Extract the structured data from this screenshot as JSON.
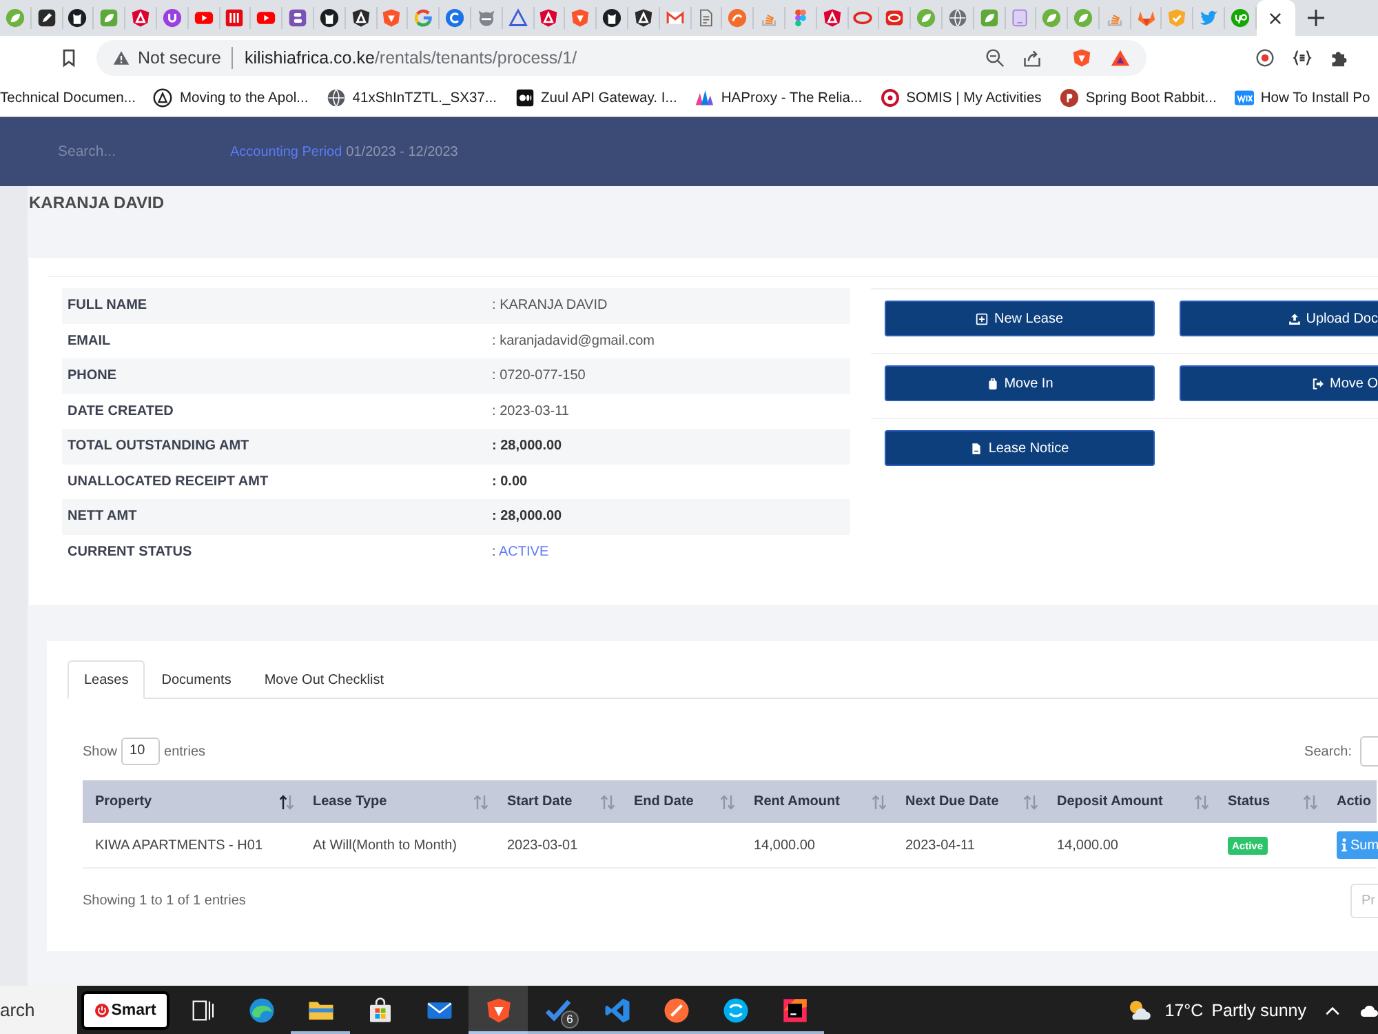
{
  "browser": {
    "tabs": [
      {
        "kind": "leaf",
        "selected": false
      },
      {
        "kind": "pencil",
        "selected": false
      },
      {
        "kind": "cat",
        "selected": false
      },
      {
        "kind": "leaf-square",
        "selected": false
      },
      {
        "kind": "shield",
        "selected": false
      },
      {
        "kind": "cup",
        "selected": false
      },
      {
        "kind": "play",
        "selected": false
      },
      {
        "kind": "stripes",
        "selected": false
      },
      {
        "kind": "play",
        "selected": false
      },
      {
        "kind": "bars",
        "selected": false
      },
      {
        "kind": "cat",
        "selected": false
      },
      {
        "kind": "dark-shield",
        "selected": false
      },
      {
        "kind": "lion",
        "selected": false
      },
      {
        "kind": "ring",
        "selected": false
      },
      {
        "kind": "arc",
        "selected": false
      },
      {
        "kind": "head",
        "selected": false
      },
      {
        "kind": "triangle",
        "selected": false
      },
      {
        "kind": "shield",
        "selected": false
      },
      {
        "kind": "lion",
        "selected": false
      },
      {
        "kind": "cat",
        "selected": false
      },
      {
        "kind": "dark-shield",
        "selected": false
      },
      {
        "kind": "envelope",
        "selected": false
      },
      {
        "kind": "scroll",
        "selected": false
      },
      {
        "kind": "swirl",
        "selected": false
      },
      {
        "kind": "stack",
        "selected": false
      },
      {
        "kind": "circles",
        "selected": false
      },
      {
        "kind": "shield",
        "selected": false
      },
      {
        "kind": "oval",
        "selected": false
      },
      {
        "kind": "oval-square",
        "selected": false
      },
      {
        "kind": "leaf",
        "selected": false
      },
      {
        "kind": "globe",
        "selected": false
      },
      {
        "kind": "leaf-square",
        "selected": false
      },
      {
        "kind": "tablet",
        "selected": false
      },
      {
        "kind": "leaf",
        "selected": false
      },
      {
        "kind": "leaf",
        "selected": false
      },
      {
        "kind": "stack",
        "selected": false
      },
      {
        "kind": "fox",
        "selected": false
      },
      {
        "kind": "check-shield",
        "selected": false
      },
      {
        "kind": "bird",
        "selected": false
      },
      {
        "kind": "loop",
        "selected": false
      },
      {
        "selected": true
      }
    ],
    "address": {
      "security": "Not secure",
      "host": "kilishiafrica.co.ke",
      "path": "/rentals/tenants/process/1/"
    },
    "bookmarks": [
      {
        "label": "Technical Documen..."
      },
      {
        "label": "Moving to the Apol...",
        "kind": "triangle-circle"
      },
      {
        "label": "41xShInTZTL._SX37...",
        "kind": "globe"
      },
      {
        "label": "Zuul API Gateway. I...",
        "kind": "dots-square"
      },
      {
        "label": "HAProxy - The Relia...",
        "kind": "peaks"
      },
      {
        "label": "SOMIS | My Activities",
        "kind": "target"
      },
      {
        "label": "Spring Boot Rabbit...",
        "kind": "blot"
      },
      {
        "label": "How To Install Po",
        "kind": "square"
      }
    ]
  },
  "header": {
    "search": {
      "placeholder": "Search..."
    },
    "period_label": "Accounting Period",
    "period": "01/2023 - 12/2023"
  },
  "title": "KARANJA DAVID",
  "details": [
    {
      "label": "FULL NAME",
      "separator": ":",
      "value": "KARANJA DAVID",
      "kind": "text"
    },
    {
      "label": "EMAIL",
      "separator": ":",
      "value": "karanjadavid@gmail.com",
      "kind": "text"
    },
    {
      "label": "PHONE",
      "separator": ":",
      "value": "0720-077-150",
      "kind": "text"
    },
    {
      "label": "DATE CREATED",
      "separator": ":",
      "value": "2023-03-11",
      "kind": "text"
    },
    {
      "label": "TOTAL OUTSTANDING AMT",
      "separator": ":",
      "value": "28,000.00",
      "kind": "amount"
    },
    {
      "label": "UNALLOCATED RECEIPT AMT",
      "separator": ":",
      "value": "0.00",
      "kind": "amount"
    },
    {
      "label": "NETT AMT",
      "separator": ":",
      "value": "28,000.00",
      "kind": "amount"
    },
    {
      "label": "CURRENT STATUS",
      "separator": ":",
      "value": "ACTIVE",
      "kind": "status"
    }
  ],
  "actions": [
    [
      {
        "label": "New Lease",
        "kind": "add"
      },
      {
        "label": "Upload Doc",
        "kind": "upload"
      }
    ],
    [
      {
        "label": "Move In",
        "kind": "move-in"
      },
      {
        "label": "Move O",
        "kind": "move-out"
      }
    ],
    [
      {
        "label": "Lease Notice",
        "kind": "notice"
      }
    ]
  ],
  "tabs": [
    {
      "label": "Leases",
      "selected": true
    },
    {
      "label": "Documents",
      "selected": false
    },
    {
      "label": "Move Out Checklist",
      "selected": false
    }
  ],
  "length": {
    "label": "Show",
    "value": "10",
    "suffix": "entries"
  },
  "search": {
    "label": "Search:"
  },
  "table": {
    "columns": [
      {
        "label": "Property",
        "sorted": true
      },
      {
        "label": "Lease Type",
        "sorted": false
      },
      {
        "label": "Start Date",
        "sorted": false
      },
      {
        "label": "End Date",
        "sorted": false
      },
      {
        "label": "Rent Amount",
        "sorted": false
      },
      {
        "label": "Next Due Date",
        "sorted": false
      },
      {
        "label": "Deposit Amount",
        "sorted": false
      },
      {
        "label": "Status",
        "sorted": false
      },
      {
        "label": "Actio"
      }
    ],
    "rows": [
      {
        "property": "KIWA APARTMENTS - H01",
        "lease_type": "At Will(Month to Month)",
        "start_date": "2023-03-01",
        "rent_amount": "14,000.00",
        "next_due_date": "2023-04-11",
        "deposit_amount": "14,000.00",
        "status": "Active",
        "action": "Sum"
      }
    ]
  },
  "info": "Showing 1 to 1 of 1 entries",
  "pagination": {
    "previous": "Pr",
    "disabled": true
  },
  "taskbar": {
    "search": {
      "placeholder": "arch"
    },
    "shortcut": "Smart",
    "apps": [
      {
        "kind": "wave",
        "running": false,
        "active": false
      },
      {
        "kind": "folder",
        "running": true,
        "active": false
      },
      {
        "kind": "bag",
        "running": false,
        "active": false
      },
      {
        "kind": "envelope",
        "running": false,
        "active": false
      },
      {
        "kind": "shield",
        "running": true,
        "active": true
      },
      {
        "kind": "check",
        "running": true,
        "active": false,
        "badge": "6"
      },
      {
        "kind": "ribbon",
        "running": true,
        "active": false
      },
      {
        "kind": "slash",
        "running": true,
        "active": false
      },
      {
        "kind": "bubble",
        "running": true,
        "active": false
      },
      {
        "kind": "square",
        "running": true,
        "active": false
      }
    ],
    "weather": {
      "temperature": "17°C",
      "condition": "Partly sunny"
    }
  }
}
